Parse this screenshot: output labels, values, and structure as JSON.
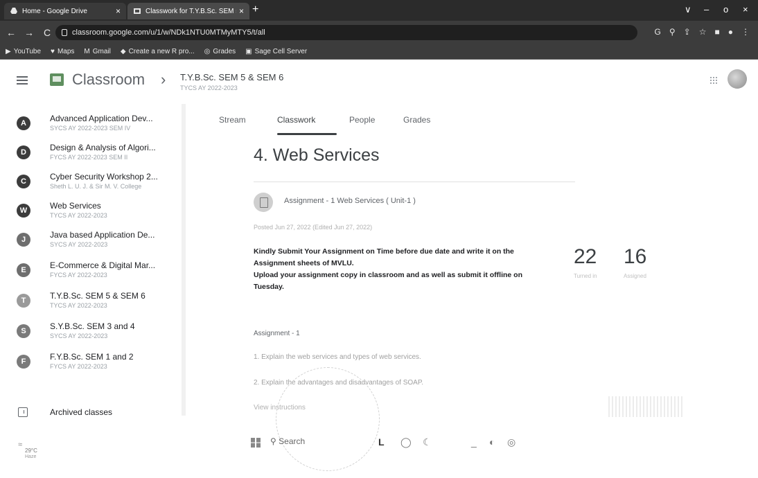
{
  "browser": {
    "tabs": [
      {
        "label": "Home - Google Drive",
        "close": "×"
      },
      {
        "label": "Classwork for T.Y.B.Sc. SEM 5 & S",
        "close": "×"
      }
    ],
    "new_tab": "+",
    "window_controls": [
      "∨",
      "–",
      "o",
      "×"
    ],
    "url": "classroom.google.com/u/1/w/NDk1NTU0MTMyMTY5/t/all",
    "bookmarks": [
      {
        "label": "YouTube",
        "icon": "youtube-icon"
      },
      {
        "label": "Maps",
        "icon": "map-pin-icon"
      },
      {
        "label": "Gmail",
        "icon": "gmail-icon"
      },
      {
        "label": "Create a new R pro...",
        "icon": "r-icon"
      },
      {
        "label": "Grades",
        "icon": "grades-icon"
      },
      {
        "label": "Sage Cell Server",
        "icon": "sage-icon"
      }
    ]
  },
  "header": {
    "app_name": "Classroom",
    "course_title": "T.Y.B.Sc. SEM 5 & SEM 6",
    "course_subtitle": "TYCS AY 2022-2023"
  },
  "sidebar": {
    "courses": [
      {
        "letter": "A",
        "name": "Advanced Application Dev...",
        "sub": "SYCS AY 2022-2023 SEM IV"
      },
      {
        "letter": "D",
        "name": "Design & Analysis of Algori...",
        "sub": "FYCS AY 2022-2023 SEM II"
      },
      {
        "letter": "C",
        "name": "Cyber Security Workshop 2...",
        "sub": "Sheth L. U. J. & Sir M. V. College"
      },
      {
        "letter": "W",
        "name": "Web Services",
        "sub": "TYCS AY 2022-2023"
      },
      {
        "letter": "J",
        "name": "Java based Application De...",
        "sub": "SYCS AY 2022-2023"
      },
      {
        "letter": "E",
        "name": "E-Commerce & Digital Mar...",
        "sub": "FYCS AY 2022-2023"
      },
      {
        "letter": "T",
        "name": "T.Y.B.Sc. SEM 5 & SEM 6",
        "sub": "TYCS AY 2022-2023"
      },
      {
        "letter": "S",
        "name": "S.Y.B.Sc. SEM 3 and 4",
        "sub": "SYCS AY 2022-2023"
      },
      {
        "letter": "F",
        "name": "F.Y.B.Sc. SEM 1 and 2",
        "sub": "FYCS AY 2022-2023"
      }
    ],
    "archived_label": "Archived classes",
    "weather": {
      "temp": "29°C",
      "desc": "Haze"
    }
  },
  "main": {
    "tabs": [
      "Stream",
      "Classwork",
      "People",
      "Grades"
    ],
    "active_tab": "Classwork",
    "topic_title": "4. Web Services",
    "assignment_title": "Assignment - 1 Web Services ( Unit-1 )",
    "posted": "Posted Jun 27, 2022 (Edited Jun 27, 2022)",
    "instructions": [
      "Kindly Submit Your Assignment on Time before due date and write it on the Assignment sheets of MVLU.",
      "Upload your assignment copy in classroom and as well as submit it offline on Tuesday."
    ],
    "stats": [
      {
        "value": "22",
        "label": "Turned in"
      },
      {
        "value": "16",
        "label": "Assigned"
      }
    ],
    "assignment_heading": "Assignment - 1",
    "questions": [
      "1.   Explain the web services and types of web services.",
      "2.   Explain the advantages and disadvantages of SOAP."
    ],
    "view_instructions": "View instructions"
  },
  "taskbar": {
    "search_label": "Search"
  }
}
